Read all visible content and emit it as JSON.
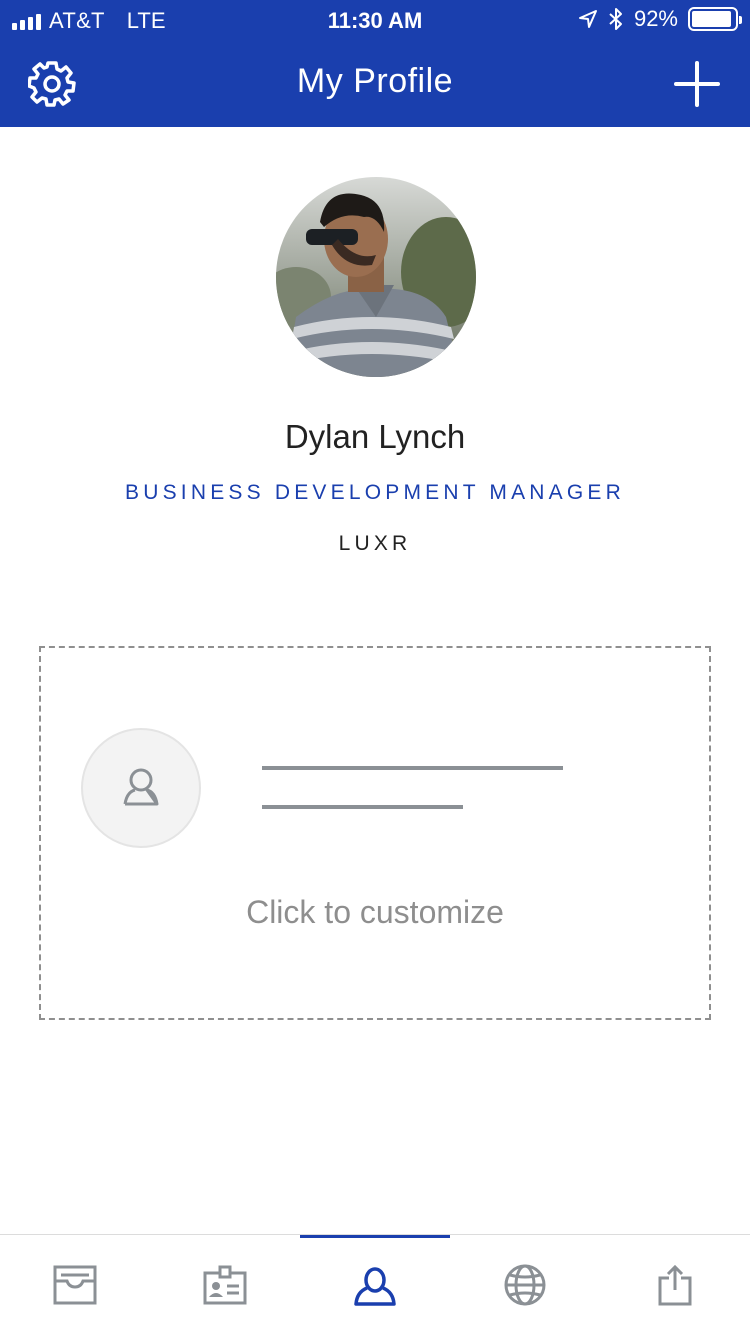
{
  "status_bar": {
    "carrier": "AT&T",
    "network": "LTE",
    "time": "11:30 AM",
    "battery": "92%",
    "battery_level": 0.92
  },
  "header": {
    "title": "My Profile",
    "settings_icon": "gear-icon",
    "add_icon": "plus-icon"
  },
  "profile": {
    "name": "Dylan Lynch",
    "job_title": "BUSINESS DEVELOPMENT MANAGER",
    "company": "LUXR"
  },
  "card": {
    "cta": "Click to customize"
  },
  "tabs": [
    {
      "icon": "inbox-icon",
      "active": false
    },
    {
      "icon": "contact-card-icon",
      "active": false
    },
    {
      "icon": "profile-icon",
      "active": true
    },
    {
      "icon": "globe-icon",
      "active": false
    },
    {
      "icon": "share-icon",
      "active": false
    }
  ],
  "colors": {
    "brand": "#1a3fae",
    "icon_gray": "#8b9095",
    "text_dark": "#222222",
    "cta_gray": "#8e8e8e"
  }
}
